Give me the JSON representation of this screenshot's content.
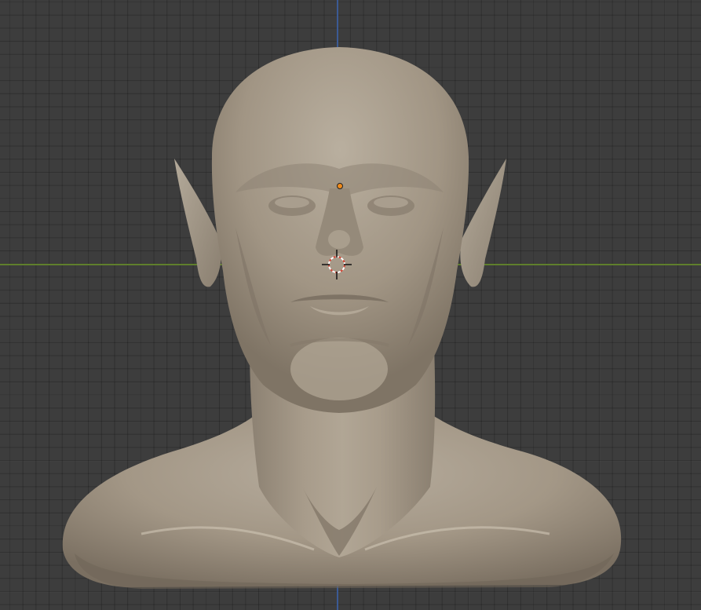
{
  "app": "Blender",
  "viewport": {
    "view": "front-orthographic",
    "grid": true,
    "axes": {
      "x_color": "#5f7f2c",
      "y_color": "#3b5a94"
    }
  },
  "scene": {
    "object": "sculpted-bust",
    "object_color": "#a69a89",
    "origin_color": "#f08a1a",
    "cursor_colors": [
      "#d44a3a",
      "#ffffff"
    ]
  }
}
